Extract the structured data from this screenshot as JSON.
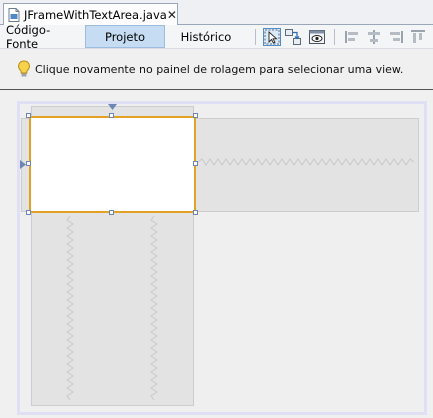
{
  "editor_tab": {
    "filename": "JFrameWithTextArea.java",
    "close": "✕"
  },
  "view_toolbar": {
    "source_label": "Código-Fonte",
    "design_label": "Projeto",
    "history_label": "Histórico",
    "active_view": "design"
  },
  "hint": {
    "text": "Clique novamente no painel de rolagem para selecionar uma view."
  },
  "icons": [
    "java-file-icon",
    "close-icon",
    "selection-mode-icon",
    "connection-mode-icon",
    "preview-design-icon",
    "align-left-icon",
    "align-center-icon",
    "align-right-icon",
    "align-top-icon",
    "lightbulb-icon"
  ],
  "colors": {
    "selection_border": "#e3a126",
    "frame_outline": "#dfe0f4",
    "scrollpane_fill": "#e3e3e3",
    "active_view_tab": "#c5dcf3"
  }
}
